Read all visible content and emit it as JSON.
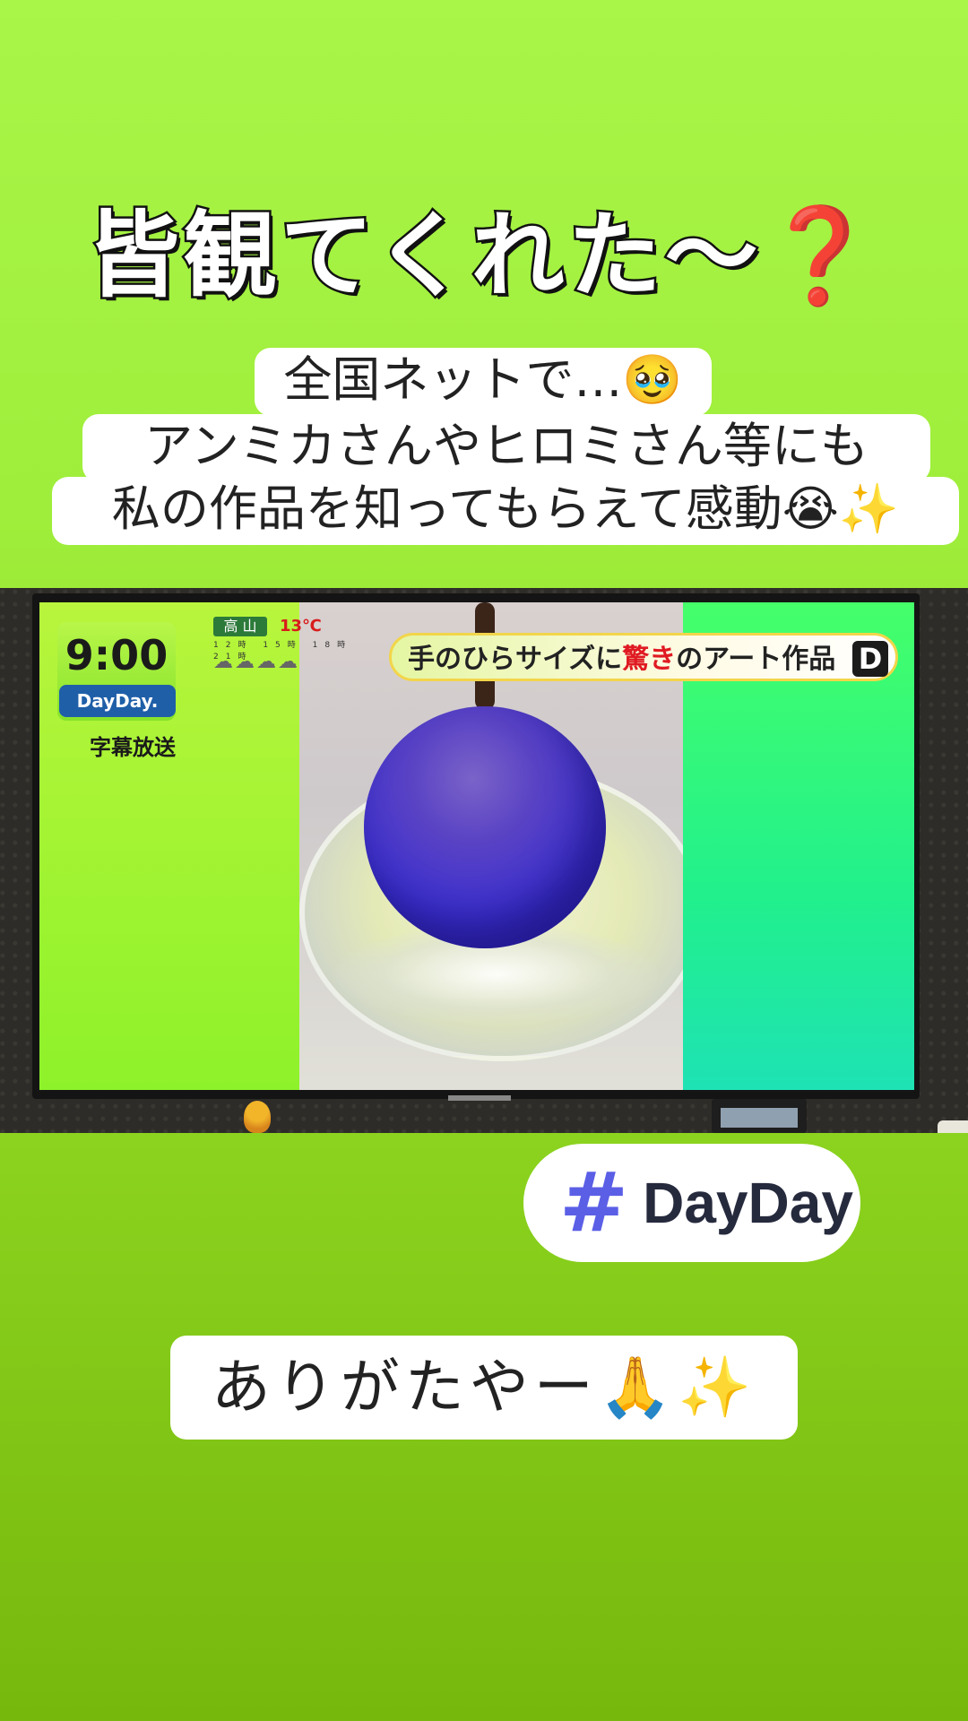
{
  "headline": {
    "text": "皆観てくれた〜",
    "emoji": "❓"
  },
  "caption": {
    "line1": "全国ネットで…🥹",
    "line2": "アンミカさんやヒロミさん等にも",
    "line3": "私の作品を知ってもらえて感動😭✨"
  },
  "tv": {
    "clock_time": "9:00",
    "clock_label": "DayDay.",
    "subtitles_badge": "字幕放送",
    "weather_city": "高 山",
    "weather_temp": "13℃",
    "weather_dates": "12時 15時 18時 21時",
    "weather_icons": "☁☁☁☁",
    "telop_before": "手のひらサイズに",
    "telop_highlight": "驚き",
    "telop_after": "のアート作品",
    "telop_logo": "D"
  },
  "hashtag": {
    "icon": "#",
    "text": "DayDay"
  },
  "thanks": {
    "text": "ありがたやー🙏✨"
  },
  "colors": {
    "background": "#9fee3b",
    "hashtag_icon": "#5b5fe6",
    "question_mark": "#d8141c"
  }
}
